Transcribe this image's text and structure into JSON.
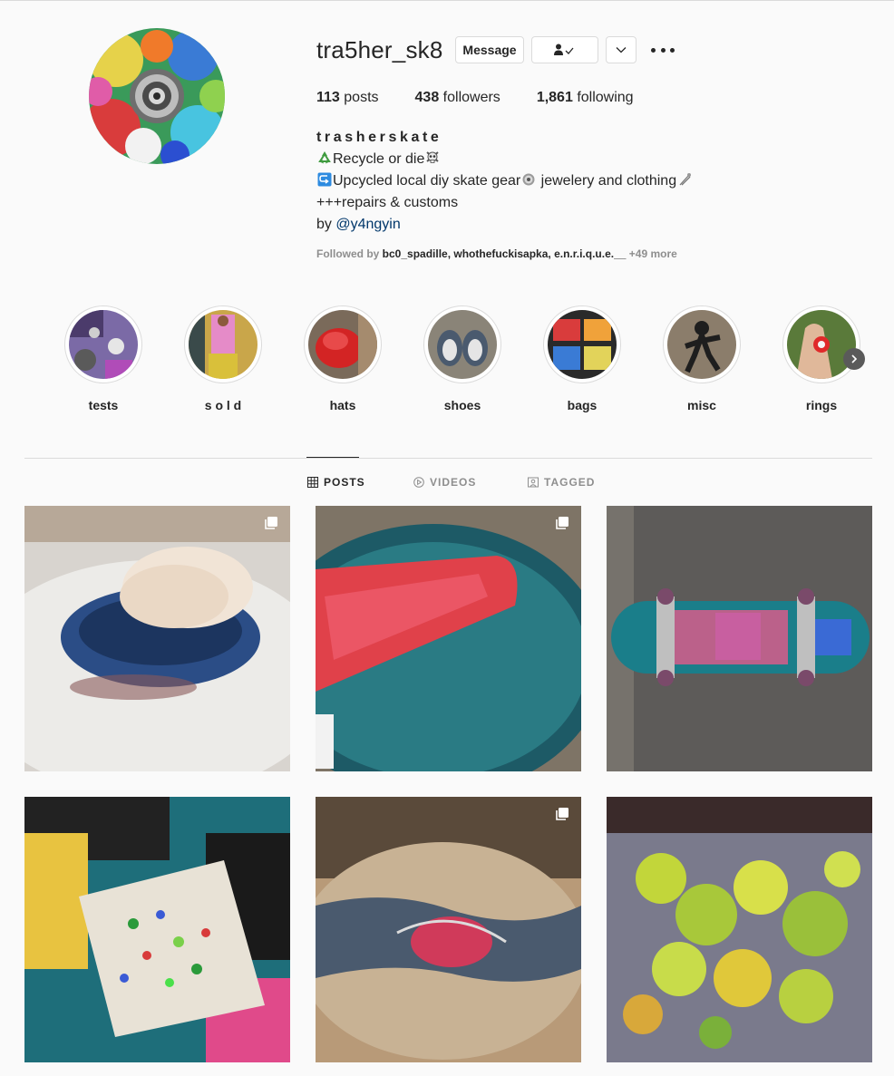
{
  "profile": {
    "username": "tra5her_sk8",
    "message_label": "Message",
    "stats": {
      "posts_count": "113",
      "posts_label": "posts",
      "followers_count": "438",
      "followers_label": "followers",
      "following_count": "1,861",
      "following_label": "following"
    },
    "full_name": "trasherskate",
    "bio": {
      "line1": "Recycle or die",
      "line2a": "Upcycled local diy skate gear",
      "line2b": " jewelery and clothing",
      "line3": "+++repairs & customs",
      "line4_prefix": "by ",
      "line4_mention": "@y4ngyin"
    },
    "followed_by": {
      "prefix": "Followed by ",
      "names": "bc0_spadille, whothefuckisapka, e.n.r.i.q.u.e.__",
      "more": " +49 more"
    }
  },
  "highlights": [
    {
      "label": "tests"
    },
    {
      "label": "s o l d"
    },
    {
      "label": "hats"
    },
    {
      "label": "shoes"
    },
    {
      "label": "bags"
    },
    {
      "label": "misc"
    },
    {
      "label": "rings"
    }
  ],
  "tabs": {
    "posts": "POSTS",
    "videos": "VIDEOS",
    "tagged": "TAGGED"
  },
  "icons": [
    "recycle-icon",
    "skull-icon",
    "arrow-icon",
    "gear-icon",
    "safety-pin-icon",
    "chevron-down-icon",
    "person-check-icon",
    "more-icon",
    "grid-icon",
    "play-icon",
    "tag-icon",
    "multiple-photos-icon",
    "chevron-right-icon"
  ],
  "colors": {
    "link": "#00376b",
    "secondary_text": "#8e8e8e",
    "border": "#dbdbdb"
  }
}
